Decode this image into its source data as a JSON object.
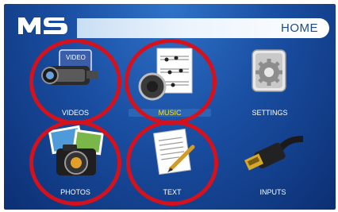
{
  "header": {
    "logo_text": "MS",
    "title": "HOME"
  },
  "menu": [
    {
      "label": "VIDEOS",
      "icon": "video-camera-icon",
      "selected": false,
      "circled": true
    },
    {
      "label": "MUSIC",
      "icon": "music-icon",
      "selected": true,
      "circled": true
    },
    {
      "label": "SETTINGS",
      "icon": "settings-icon",
      "selected": false,
      "circled": false
    },
    {
      "label": "PHOTOS",
      "icon": "camera-icon",
      "selected": false,
      "circled": true
    },
    {
      "label": "TEXT",
      "icon": "document-icon",
      "selected": false,
      "circled": true
    },
    {
      "label": "INPUTS",
      "icon": "hdmi-cable-icon",
      "selected": false,
      "circled": false
    }
  ],
  "colors": {
    "background": "#1a4fa3",
    "selected_label": "#ffe02a",
    "annotation_ring": "#d3121d"
  }
}
